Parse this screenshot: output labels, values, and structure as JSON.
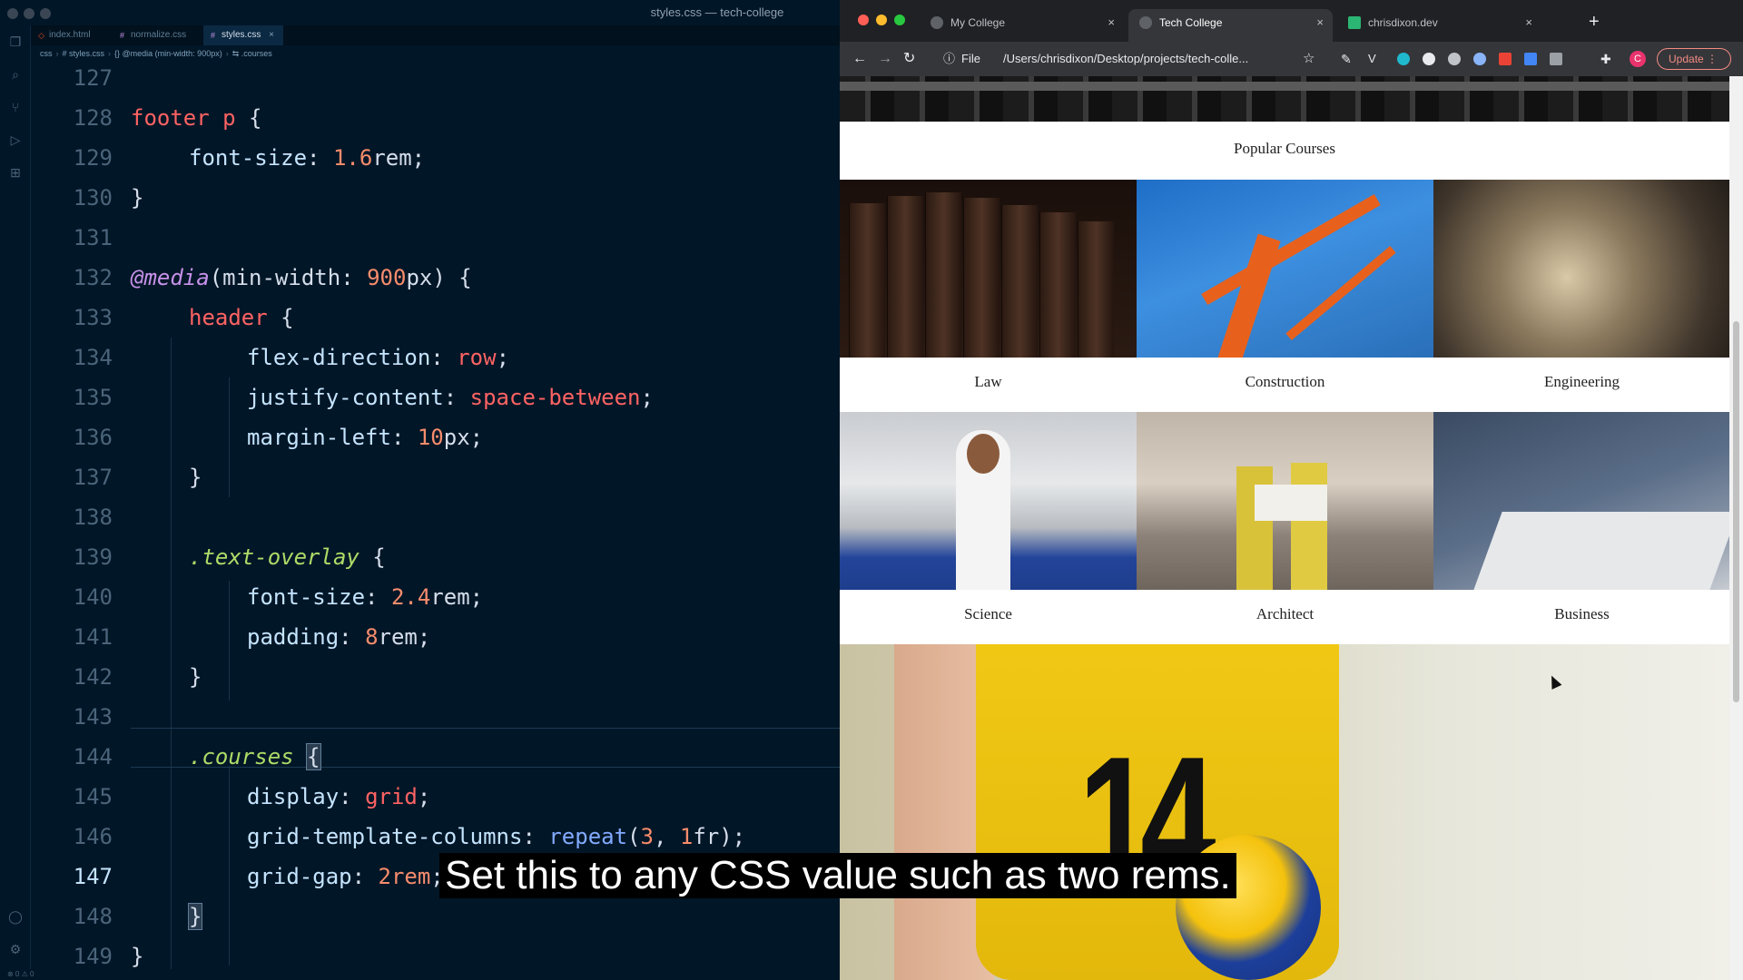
{
  "editor": {
    "window_title": "styles.css — tech-college",
    "tabs": [
      {
        "label": "index.html",
        "icon": "html-file-icon"
      },
      {
        "label": "normalize.css",
        "icon": "css-file-icon"
      },
      {
        "label": "styles.css",
        "icon": "css-file-icon",
        "close": "×"
      }
    ],
    "breadcrumb": [
      "css",
      "# styles.css",
      "{} @media (min-width: 900px)",
      "⇆ .courses"
    ],
    "line_numbers": [
      "127",
      "128",
      "129",
      "130",
      "131",
      "132",
      "133",
      "134",
      "135",
      "136",
      "137",
      "138",
      "139",
      "140",
      "141",
      "142",
      "143",
      "144",
      "145",
      "146",
      "147",
      "148",
      "149"
    ],
    "current_line": "147",
    "code": {
      "l128": [
        "footer p",
        " {"
      ],
      "l129": [
        "font-size",
        ": ",
        "1.6",
        "rem",
        ";"
      ],
      "l130": [
        "}"
      ],
      "l132": [
        "@media",
        "(min-width: ",
        "900",
        "px",
        ") {"
      ],
      "l133": [
        "header",
        " {"
      ],
      "l134": [
        "flex-direction",
        ": ",
        "row",
        ";"
      ],
      "l135": [
        "justify-content",
        ": ",
        "space-between",
        ";"
      ],
      "l136": [
        "margin-left",
        ": ",
        "10",
        "px",
        ";"
      ],
      "l137": [
        "}"
      ],
      "l139": [
        ".text-overlay",
        " {"
      ],
      "l140": [
        "font-size",
        ": ",
        "2.4",
        "rem",
        ";"
      ],
      "l141": [
        "padding",
        ": ",
        "8",
        "rem",
        ";"
      ],
      "l142": [
        "}"
      ],
      "l144": [
        ".courses",
        " ",
        "{"
      ],
      "l145": [
        "display",
        ": ",
        "grid",
        ";"
      ],
      "l146": [
        "grid-template-columns",
        ": ",
        "repeat",
        "(",
        "3",
        ", ",
        "1",
        "fr",
        ");"
      ],
      "l147": [
        "grid-gap",
        ": ",
        "2rem",
        ";"
      ],
      "l148": [
        "}"
      ],
      "l149": [
        "}"
      ]
    },
    "status": "⊗ 0 ⚠ 0"
  },
  "browser": {
    "tabs": [
      {
        "label": "My College",
        "close": "×"
      },
      {
        "label": "Tech College",
        "close": "×"
      },
      {
        "label": "chrisdixon.dev",
        "close": "×"
      }
    ],
    "new_tab": "+",
    "omnibox": {
      "scheme_label": "File",
      "url": "/Users/chrisdixon/Desktop/projects/tech-colle..."
    },
    "update_label": "Update",
    "avatar_letter": "C",
    "page": {
      "section_title": "Popular Courses",
      "courses": [
        {
          "label": "Law",
          "image": "law-books-image"
        },
        {
          "label": "Construction",
          "image": "construction-crane-image"
        },
        {
          "label": "Engineering",
          "image": "engineering-machine-image"
        },
        {
          "label": "Science",
          "image": "science-lab-image"
        },
        {
          "label": "Architect",
          "image": "architect-site-image"
        },
        {
          "label": "Business",
          "image": "business-signing-image"
        }
      ],
      "hero_jersey_number": "14"
    }
  },
  "subtitle": "Set this to any CSS value such as two rems.",
  "colors": {
    "editor_bg": "#011627",
    "browser_chrome": "#202124",
    "accent_red": "#ff6363"
  }
}
